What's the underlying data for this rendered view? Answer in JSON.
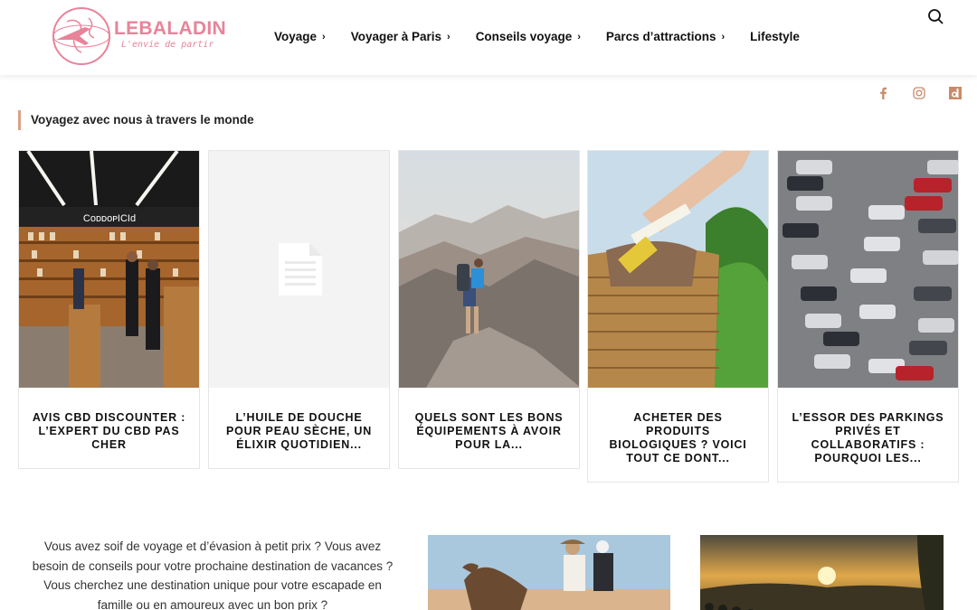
{
  "brand": {
    "name": "LEBALADIN",
    "tagline": "L'envie de partir",
    "color": "#e8839a"
  },
  "nav": [
    {
      "label": "Voyage",
      "has_submenu": true
    },
    {
      "label": "Voyager à Paris",
      "has_submenu": true
    },
    {
      "label": "Conseils voyage",
      "has_submenu": true
    },
    {
      "label": "Parcs d’attractions",
      "has_submenu": true
    },
    {
      "label": "Lifestyle",
      "has_submenu": false
    }
  ],
  "icons": {
    "search": "search-icon",
    "chevron": "›",
    "social": [
      "facebook-icon",
      "instagram-icon",
      "dailymotion-icon"
    ]
  },
  "section": {
    "title": "Voyagez avec nous à travers le monde",
    "accent": "#d9a282"
  },
  "cards": [
    {
      "title": "AVIS CBD DISCOUNTER : L’EXPERT DU CBD PAS CHER",
      "image": "cbd-store",
      "store_sign": "CᴏᴅᴅᴏᴘICId"
    },
    {
      "title": "L’HUILE DE DOUCHE POUR PEAU SÈCHE, UN ÉLIXIR QUOTIDIEN...",
      "image": "placeholder-document"
    },
    {
      "title": "QUELS SONT LES BONS ÉQUIPEMENTS À AVOIR POUR LA...",
      "image": "hiker-mountains"
    },
    {
      "title": "ACHETER DES PRODUITS BIOLOGIQUES ? VOICI TOUT CE DONT...",
      "image": "basket-hand"
    },
    {
      "title": "L’ESSOR DES PARKINGS PRIVÉS ET COLLABORATIFS : POURQUOI LES...",
      "image": "parking-lot"
    }
  ],
  "intro": {
    "text": "Vous avez soif de voyage et d’évasion à petit prix ? Vous avez besoin de conseils pour votre prochaine destination de vacances ? Vous cherchez une destination unique pour votre escapade en famille ou en amoureux avec un bon prix ?"
  },
  "bottom_images": [
    "camel-desert",
    "sunset-landscape"
  ]
}
